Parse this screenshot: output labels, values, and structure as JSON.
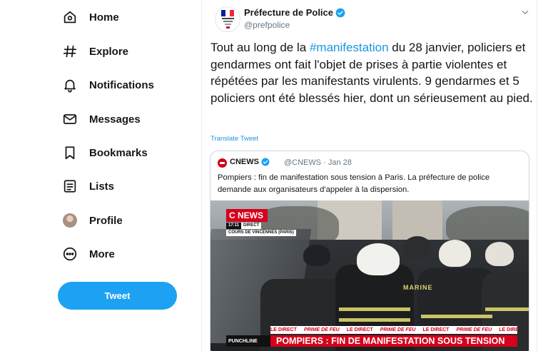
{
  "nav": {
    "items": [
      {
        "label": "Home",
        "icon": "home-icon"
      },
      {
        "label": "Explore",
        "icon": "hashtag-icon"
      },
      {
        "label": "Notifications",
        "icon": "bell-icon"
      },
      {
        "label": "Messages",
        "icon": "envelope-icon"
      },
      {
        "label": "Bookmarks",
        "icon": "bookmark-icon"
      },
      {
        "label": "Lists",
        "icon": "list-icon"
      },
      {
        "label": "Profile",
        "icon": "avatar"
      },
      {
        "label": "More",
        "icon": "more-circle-icon"
      }
    ],
    "tweet_button": "Tweet"
  },
  "tweet": {
    "author_name": "Préfecture de Police",
    "author_handle": "@prefpolice",
    "text_before": "Tout au long de la ",
    "hashtag": "#manifestation",
    "text_after": " du 28 janvier, policiers et gendarmes ont fait l'objet de prises à partie violentes et répétées par les manifestants virulents. 9 gendarmes et 5 policiers ont été blessés hier, dont un sérieusement au pied.",
    "translate_label": "Translate Tweet"
  },
  "quoted": {
    "name": "CNEWS",
    "handle": "@CNEWS · Jan 28",
    "text": "Pompiers : fin de manifestation sous tension à Paris. La préfecture de police demande aux organisateurs d'appeler à la dispersion.",
    "media": {
      "channel_logo": "C NEWS",
      "time": "17:11",
      "live": "DIRECT",
      "location": "COURS DE VINCENNES (PARIS)",
      "ticker_live": "LE DIRECT",
      "ticker_topic": "PRIME DE FEU",
      "show_name": "PUNCHLINE",
      "headline": "POMPIERS : FIN DE MANIFESTATION SOUS TENSION",
      "jacket_text": "MARINE"
    }
  },
  "colors": {
    "accent": "#1da1f2",
    "link": "#1b95e0",
    "cnews_red": "#d6001c"
  }
}
